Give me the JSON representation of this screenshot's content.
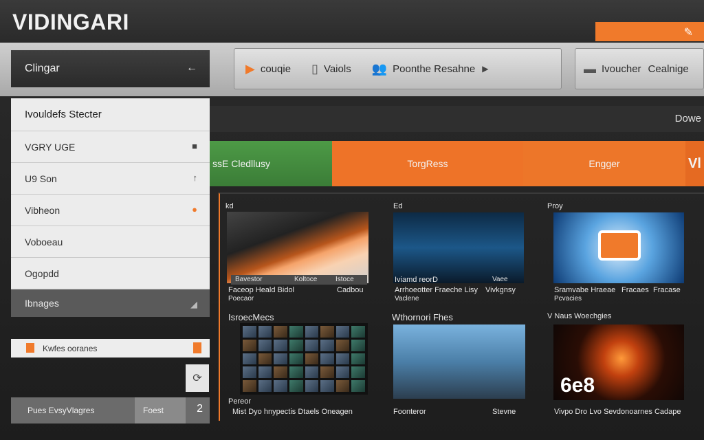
{
  "app": {
    "brand": "VIDINGARI"
  },
  "topbar": {
    "action_icon": "edit-icon"
  },
  "toolbar": {
    "group1": {
      "items": [
        {
          "label": "couqie",
          "icon": "video-icon"
        },
        {
          "label": "Vaiols",
          "icon": "phone-icon"
        },
        {
          "label": "Poonthe Resahne",
          "icon": "users-icon"
        }
      ]
    },
    "group2": {
      "items": [
        {
          "label": "Ivoucher",
          "icon": "monitor-icon"
        },
        {
          "label": "Cealnige",
          "icon": ""
        }
      ]
    }
  },
  "sidebar": {
    "header": "Clingar",
    "back_glyph": "←",
    "title_item": "Ivouldefs Stecter",
    "items": [
      {
        "label": "VGRY UGE"
      },
      {
        "label": "U9 Son"
      },
      {
        "label": "Vibheon"
      },
      {
        "label": "Voboeau"
      },
      {
        "label": "Ogopdd"
      },
      {
        "label": "Ibnages"
      }
    ],
    "footer_label": "Kwfes ooranes",
    "refresh_glyph": "⟳",
    "bottom": {
      "label": "Pues EvsyVlagres",
      "label2": "Foest",
      "num": "2"
    }
  },
  "main": {
    "header_right": "Dowe",
    "tabs": [
      {
        "label": "ssE Cledllusy"
      },
      {
        "label": "TorgRess"
      },
      {
        "label": "Engger"
      },
      {
        "label": "Vl"
      }
    ],
    "cards": [
      {
        "top": "kd",
        "caption1": "Bavestor",
        "caption1b": "Koltoce",
        "caption1c": "Istoce",
        "caption2": "Faceop Heald Bidol",
        "caption2b": "Cadbou",
        "caption3": "Poecaor"
      },
      {
        "top": "Ed",
        "caption1": "Iviamd reorD",
        "caption1b": "Vaee",
        "caption2": "Arrhoeotter Fraeche Lisy",
        "caption2b": "Vivkgnsy",
        "caption3": "Vaclene"
      },
      {
        "top": "Proy",
        "caption1": "Sramvabe Hraeae",
        "caption1b": "Fracaes",
        "caption1c": "Fracase",
        "caption3": "Pcvacies"
      },
      {
        "top": "IsroecMecs",
        "caption1": "Pereor",
        "caption2": "Mist Dyo hnypectis Dtaels Oneagen"
      },
      {
        "top": "Wthornori Fhes",
        "caption1": "Foonteror",
        "caption2": "Stevne"
      },
      {
        "top": "V  Naus Woechgies",
        "caption1": "Vivpo Dro Lvo Sevdonoarnes Cadape",
        "overlay": "6e8"
      }
    ]
  }
}
